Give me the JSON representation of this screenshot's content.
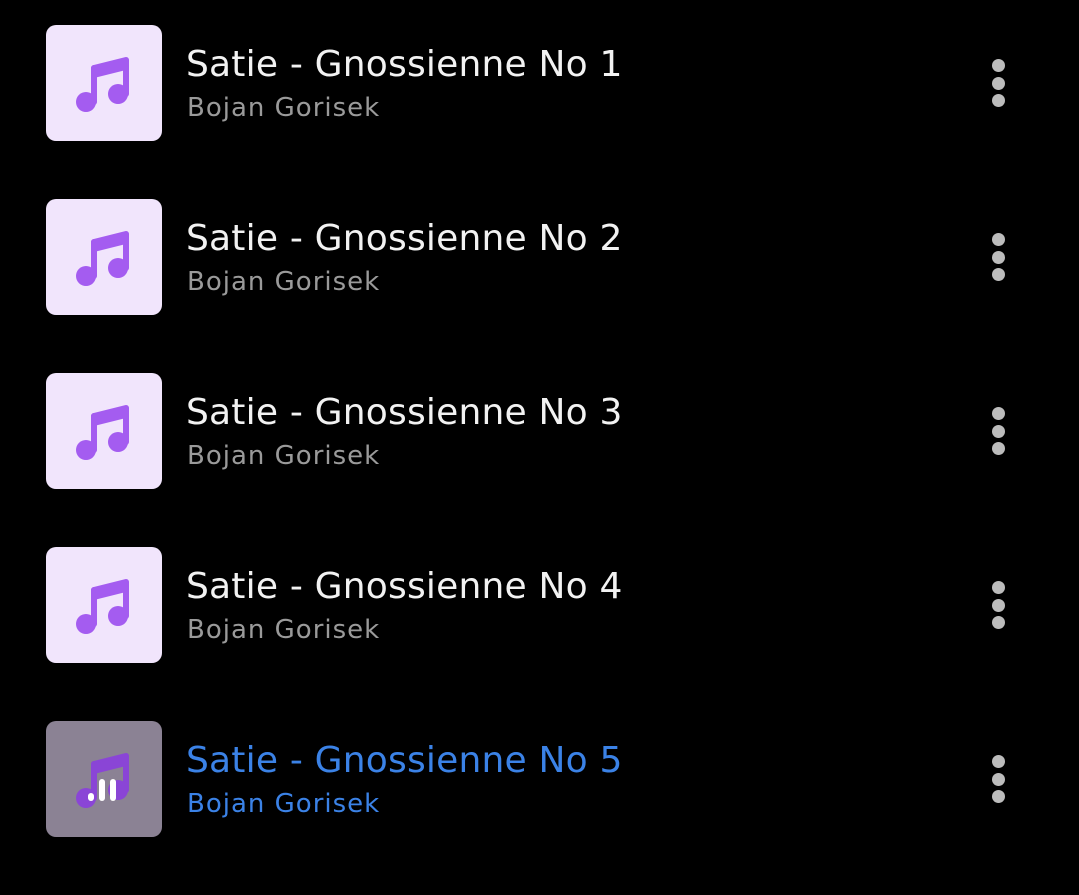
{
  "colors": {
    "background": "#000000",
    "thumb_background": "#f1e5fc",
    "thumb_playing_background": "#8b8294",
    "note_color": "#a45cf0",
    "title_color": "#f2f2f2",
    "artist_color": "#9a9a9a",
    "active_color": "#3b82e6",
    "menu_dots_color": "#bcbcbc"
  },
  "tracks": [
    {
      "title": "Satie - Gnossienne No 1",
      "artist": "Bojan Gorisek",
      "icon": "music-note-icon",
      "playing": false
    },
    {
      "title": "Satie - Gnossienne No 2",
      "artist": "Bojan Gorisek",
      "icon": "music-note-icon",
      "playing": false
    },
    {
      "title": "Satie - Gnossienne No 3",
      "artist": "Bojan Gorisek",
      "icon": "music-note-icon",
      "playing": false
    },
    {
      "title": "Satie - Gnossienne No 4",
      "artist": "Bojan Gorisek",
      "icon": "music-note-icon",
      "playing": false
    },
    {
      "title": "Satie - Gnossienne No 5",
      "artist": "Bojan Gorisek",
      "icon": "now-playing-bars-icon",
      "playing": true
    }
  ],
  "menu_icon": "more-vertical-icon"
}
